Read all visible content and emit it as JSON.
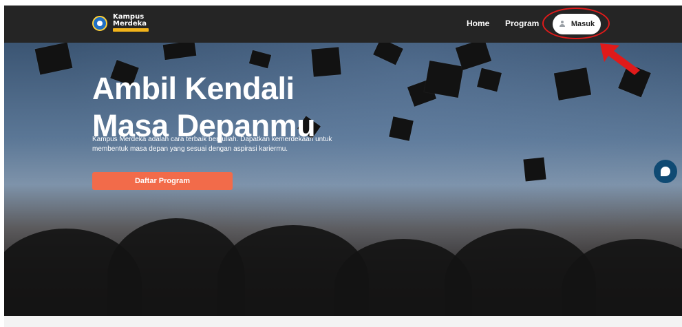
{
  "navbar": {
    "logo_line1": "Kampus",
    "logo_line2": "Merdeka",
    "links": [
      "Home",
      "Program"
    ],
    "login_label": "Masuk"
  },
  "hero": {
    "title_line1": "Ambil Kendali",
    "title_line2": "Masa Depanmu",
    "subtitle": "Kampus Merdeka adalah cara terbaik berkuliah. Dapatkan kemerdekaan untuk membentuk masa depan yang sesuai dengan aspirasi karier​mu.",
    "cta_label": "Daftar Program"
  },
  "colors": {
    "navbar_bg": "#252525",
    "cta": "#f26b4a",
    "chat_button": "#0f4a73",
    "annotation": "#e01a1a"
  },
  "icons": {
    "login": "user-icon",
    "chat": "chat-icon",
    "annotation_arrow": "arrow-icon"
  }
}
